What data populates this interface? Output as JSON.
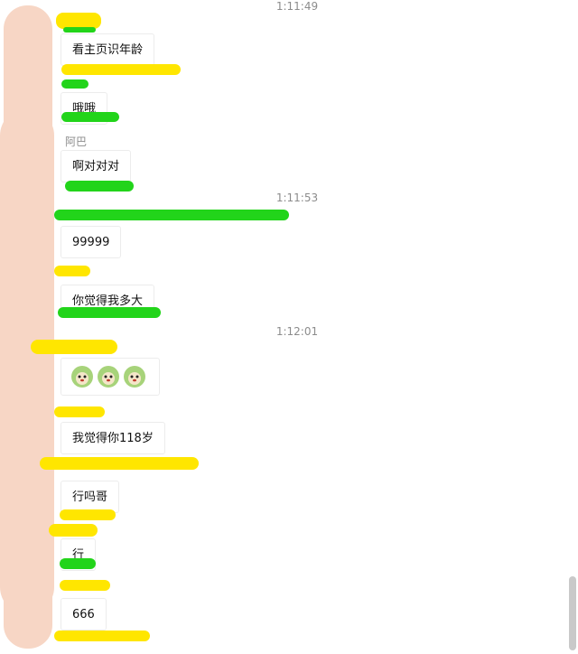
{
  "chat": {
    "colors": {
      "bubble_bg": "#ffffff",
      "bubble_border": "#ececec",
      "timestamp": "#8c8c8c",
      "redact_yellow": "#ffe600",
      "redact_green": "#22d41a",
      "redact_skin": "#f7d6c5"
    },
    "timestamps": [
      "1:11:49",
      "1:11:53",
      "1:12:01"
    ],
    "messages": [
      {
        "text": "看主页识年龄"
      },
      {
        "text": "哦哦"
      },
      {
        "sender": "阿巴",
        "text": "啊对对对"
      },
      {
        "text": "99999"
      },
      {
        "text": "你觉得我多大"
      },
      {
        "sticker": "cabbage-dog-sticker",
        "count": 3
      },
      {
        "text": "我觉得你118岁"
      },
      {
        "text": "行吗哥"
      },
      {
        "text": "行"
      },
      {
        "text": "666"
      }
    ]
  }
}
